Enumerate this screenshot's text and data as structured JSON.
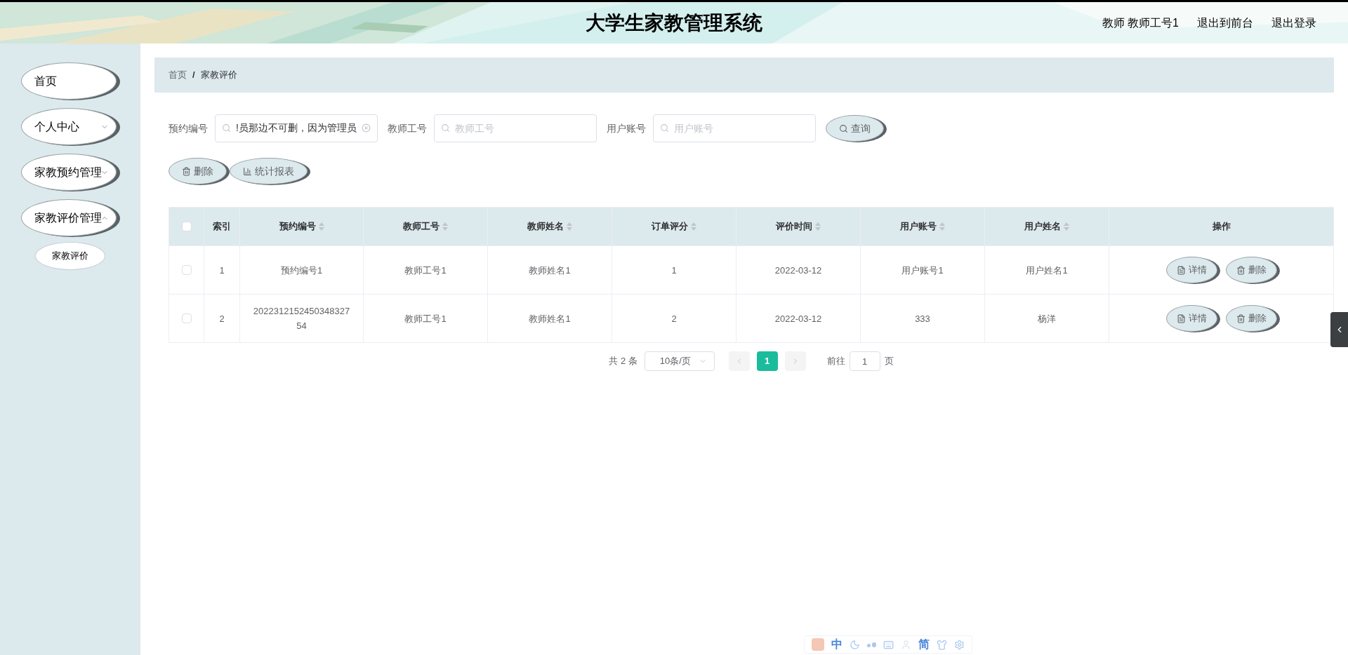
{
  "header": {
    "title": "大学生家教管理系统",
    "user": "教师 教师工号1",
    "links": [
      "退出到前台",
      "退出登录"
    ]
  },
  "sidebar": {
    "items": [
      {
        "label": "首页",
        "kind": "link"
      },
      {
        "label": "个人中心",
        "kind": "submenu",
        "expanded": false
      },
      {
        "label": "家教预约管理",
        "kind": "submenu",
        "expanded": false
      },
      {
        "label": "家教评价管理",
        "kind": "submenu",
        "expanded": true,
        "children": [
          {
            "label": "家教评价"
          }
        ]
      }
    ]
  },
  "breadcrumb": [
    "首页",
    "家教评价"
  ],
  "breadcrumb_separator": "/",
  "search": {
    "fields": [
      {
        "label": "预约编号",
        "value": "!员那边不可删，因为管理员"
      },
      {
        "label": "教师工号",
        "placeholder": "教师工号"
      },
      {
        "label": "用户账号",
        "placeholder": "用户账号"
      }
    ],
    "button": "查询"
  },
  "toolbar": [
    {
      "label": "删除",
      "kind": "delete"
    },
    {
      "label": "统计报表",
      "kind": "chart"
    }
  ],
  "table": {
    "columns": [
      {
        "label": "索引",
        "sortable": false
      },
      {
        "label": "预约编号",
        "sortable": true
      },
      {
        "label": "教师工号",
        "sortable": true
      },
      {
        "label": "教师姓名",
        "sortable": true
      },
      {
        "label": "订单评分",
        "sortable": true
      },
      {
        "label": "评价时间",
        "sortable": true
      },
      {
        "label": "用户账号",
        "sortable": true
      },
      {
        "label": "用户姓名",
        "sortable": true
      },
      {
        "label": "操作",
        "sortable": false
      }
    ],
    "all_checked": false,
    "rows": [
      {
        "checked": false,
        "cells": [
          "1",
          "预约编号1",
          "教师工号1",
          "教师姓名1",
          "1",
          "2022-03-12",
          "用户账号1",
          "用户姓名1"
        ],
        "actions": [
          {
            "label": "详情",
            "kind": "detail"
          },
          {
            "label": "删除",
            "kind": "delete"
          }
        ]
      },
      {
        "checked": false,
        "cells": [
          "2",
          "202231215245034832754",
          "教师工号1",
          "教师姓名1",
          "2",
          "2022-03-12",
          "333",
          "杨洋"
        ],
        "actions": [
          {
            "label": "详情",
            "kind": "detail"
          },
          {
            "label": "删除",
            "kind": "delete"
          }
        ]
      }
    ]
  },
  "pagination": {
    "total": "共 2 条",
    "page_size": "10条/页",
    "pages": [
      {
        "label": "1",
        "selected": true
      }
    ],
    "goto_label": "前往",
    "goto_value": "1",
    "goto_suffix": "页"
  },
  "ime_toolbar": [
    {
      "kind": "logo"
    },
    {
      "kind": "text",
      "label": "中"
    },
    {
      "kind": "moon"
    },
    {
      "kind": "punct"
    },
    {
      "kind": "keyboard"
    },
    {
      "kind": "user"
    },
    {
      "kind": "text",
      "label": "简"
    },
    {
      "kind": "shirt"
    },
    {
      "kind": "gear"
    }
  ]
}
